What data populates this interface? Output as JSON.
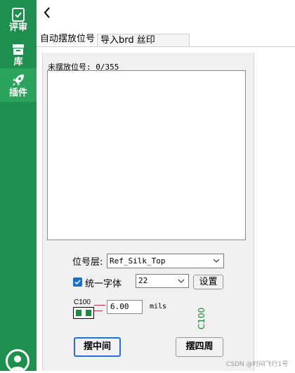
{
  "sidebar": {
    "items": [
      {
        "label": "评审",
        "icon": "check-icon"
      },
      {
        "label": "库",
        "icon": "box-icon"
      },
      {
        "label": "插件",
        "icon": "rocket-icon"
      }
    ],
    "active_index": 2,
    "colors": {
      "bg": "#1f8f4e",
      "active": "#2aa35c"
    }
  },
  "tabs": [
    {
      "label": "自动摆放位号"
    },
    {
      "label": "导入brd 丝印"
    }
  ],
  "status": {
    "unplaced": "未摆放位号: 0/355"
  },
  "layer": {
    "label": "位号层:",
    "value": "Ref_Silk_Top"
  },
  "font": {
    "checkbox_label": "统一字体",
    "checked": true,
    "value": "22",
    "set_button": "设置"
  },
  "footprint": {
    "ref": "C100",
    "offset_value": "6.00",
    "unit": "mils",
    "preview_text": "C100"
  },
  "buttons": {
    "center": "摆中间",
    "around": "摆四周"
  },
  "watermark": "CSDN @时间飞行1号"
}
